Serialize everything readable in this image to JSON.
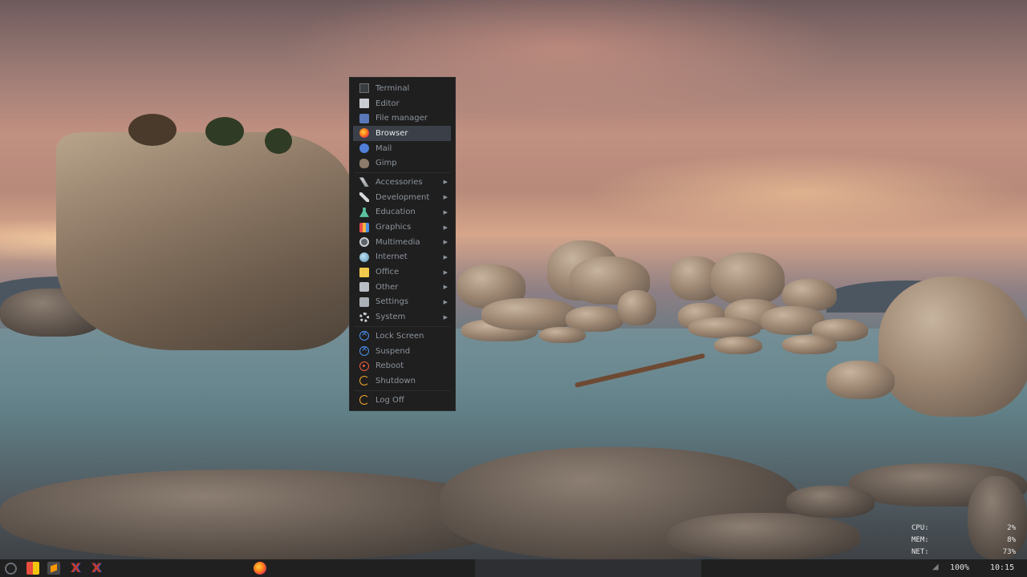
{
  "menu": {
    "apps": [
      {
        "label": "Terminal",
        "icon": "terminal-icon"
      },
      {
        "label": "Editor",
        "icon": "editor-icon"
      },
      {
        "label": "File manager",
        "icon": "file-manager-icon"
      },
      {
        "label": "Browser",
        "icon": "firefox-icon",
        "active": true
      },
      {
        "label": "Mail",
        "icon": "mail-icon"
      },
      {
        "label": "Gimp",
        "icon": "gimp-icon"
      }
    ],
    "categories": [
      {
        "label": "Accessories",
        "icon": "accessories-icon"
      },
      {
        "label": "Development",
        "icon": "development-icon"
      },
      {
        "label": "Education",
        "icon": "education-icon"
      },
      {
        "label": "Graphics",
        "icon": "graphics-icon"
      },
      {
        "label": "Multimedia",
        "icon": "multimedia-icon"
      },
      {
        "label": "Internet",
        "icon": "internet-icon"
      },
      {
        "label": "Office",
        "icon": "office-icon"
      },
      {
        "label": "Other",
        "icon": "other-icon"
      },
      {
        "label": "Settings",
        "icon": "settings-icon"
      },
      {
        "label": "System",
        "icon": "system-icon"
      }
    ],
    "session": [
      {
        "label": "Lock Screen",
        "icon": "lock-screen-icon"
      },
      {
        "label": "Suspend",
        "icon": "suspend-icon"
      },
      {
        "label": "Reboot",
        "icon": "reboot-icon"
      },
      {
        "label": "Shutdown",
        "icon": "shutdown-icon"
      }
    ],
    "logoff": {
      "label": "Log Off",
      "icon": "log-off-icon"
    },
    "submenu_arrow": "▶"
  },
  "sysmon": {
    "cpu_label": "CPU:",
    "cpu_value": "2%",
    "mem_label": "MEM:",
    "mem_value": "8%",
    "net_label": "NET:",
    "net_value": "73%"
  },
  "taskbar": {
    "battery": "100%",
    "clock": "10:15",
    "icons": [
      "app-menu-icon",
      "palette-icon",
      "sublime-text-icon",
      "x-app-icon",
      "x-app-icon",
      "firefox-icon",
      "wifi-icon"
    ]
  },
  "colors": {
    "menu_bg": "#1f1f1f",
    "menu_active": "#3a3f48",
    "taskbar_bg": "#202020"
  }
}
